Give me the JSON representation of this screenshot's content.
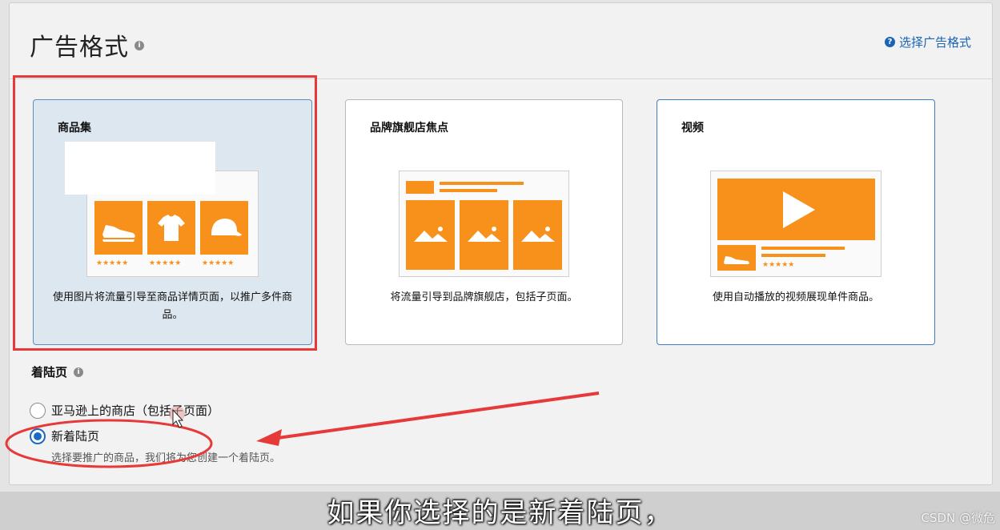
{
  "header": {
    "title": "广告格式",
    "title_info_icon": "info-icon",
    "help_link": "选择广告格式",
    "help_icon": "help-icon"
  },
  "cards": [
    {
      "title": "商品集",
      "description": "使用图片将流量引导至商品详情页面，以推广多件商品。",
      "selected": true,
      "stars": "★★★★★"
    },
    {
      "title": "品牌旗舰店焦点",
      "description": "将流量引导到品牌旗舰店，包括子页面。",
      "selected": false
    },
    {
      "title": "视频",
      "description": "使用自动播放的视频展现单件商品。",
      "selected": false,
      "stars": "★★★★★"
    }
  ],
  "landing": {
    "label": "着陆页",
    "options": [
      {
        "label": "亚马逊上的商店（包括子页面）",
        "checked": false
      },
      {
        "label": "新着陆页",
        "checked": true
      }
    ],
    "new_page_hint": "选择要推广的商品，我们将为您创建一个着陆页。"
  },
  "subtitle": "如果你选择的是新着陆页，",
  "watermark": "CSDN @微危",
  "colors": {
    "accent_orange": "#f7911c",
    "link_blue": "#1a63b6",
    "annotation_red": "#e6393a"
  }
}
